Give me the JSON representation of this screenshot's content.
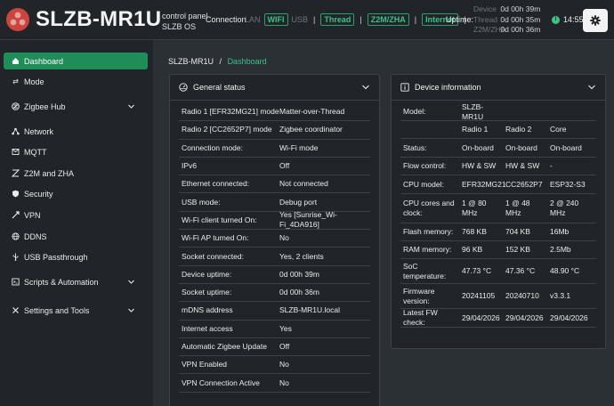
{
  "header": {
    "brand": "SLZB-MR1U",
    "sub_line1": "control panel",
    "sub_line2": "SLZB OS",
    "connection_label": "Connection",
    "conn": {
      "lan": "LAN",
      "wifi": "WIFI",
      "usb": "USB",
      "thread": "Thread",
      "z2m": "Z2M/ZHA",
      "internet": "Internet"
    },
    "uptime_label": "Uptime:",
    "uptime": [
      {
        "key": "Device",
        "value": "0d 00h 39m"
      },
      {
        "key": "Thread",
        "value": "0d 00h 35m"
      },
      {
        "key": "Z2M/ZHA",
        "value": "0d 00h 36m"
      }
    ],
    "time": "14:55",
    "accent": "#3cc287",
    "logo_color": "#c9453e"
  },
  "sidebar": {
    "items": [
      {
        "label": "Dashboard",
        "icon": "home-icon",
        "active": true
      },
      {
        "label": "Mode",
        "icon": "swap-icon"
      },
      {
        "label": "Zigbee Hub",
        "icon": "zigbee-icon",
        "chevron": true
      },
      {
        "label": "Network",
        "icon": "network-icon"
      },
      {
        "label": "MQTT",
        "icon": "mqtt-icon"
      },
      {
        "label": "Z2M and ZHA",
        "icon": "z2m-icon"
      },
      {
        "label": "Security",
        "icon": "shield-icon"
      },
      {
        "label": "VPN",
        "icon": "vpn-icon"
      },
      {
        "label": "DDNS",
        "icon": "ddns-icon"
      },
      {
        "label": "USB Passthrough",
        "icon": "usb-icon"
      },
      {
        "label": "Scripts & Automation",
        "icon": "code-icon",
        "chevron": true
      },
      {
        "label": "Settings and Tools",
        "icon": "tools-icon",
        "chevron": true
      }
    ]
  },
  "breadcrumb": {
    "root": "SLZB-MR1U",
    "sep": "/",
    "current": "Dashboard"
  },
  "general": {
    "title": "General status",
    "rows": [
      {
        "k": "Radio 1 [EFR32MG21] mode",
        "v": "Matter-over-Thread"
      },
      {
        "k": "Radio 2 [CC2652P7] mode",
        "v": "Zigbee coordinator"
      },
      {
        "k": "Connection mode:",
        "v": "Wi-Fi mode"
      },
      {
        "k": "IPv6",
        "v": "Off"
      },
      {
        "k": "Ethernet connected:",
        "v": "Not connected"
      },
      {
        "k": "USB mode:",
        "v": "Debug port"
      },
      {
        "k": "Wi-Fi client turned On:",
        "v": "Yes [Sunrise_Wi-Fi_4DA916]"
      },
      {
        "k": "Wi-Fi AP turned On:",
        "v": "No"
      },
      {
        "k": "Socket connected:",
        "v": "Yes, 2 clients"
      },
      {
        "k": "Device uptime:",
        "v": "0d 00h 39m"
      },
      {
        "k": "Socket uptime:",
        "v": "0d 00h 36m"
      },
      {
        "k": "mDNS address",
        "v": "SLZB-MR1U.local"
      },
      {
        "k": "Internet access",
        "v": "Yes"
      },
      {
        "k": "Automatic Zigbee Update",
        "v": "Off"
      },
      {
        "k": "VPN Enabled",
        "v": "No"
      },
      {
        "k": "VPN Connection Active",
        "v": "No"
      }
    ]
  },
  "device": {
    "title": "Device information",
    "rows": [
      {
        "k": "Model:",
        "a": "SLZB-MR1U",
        "b": "",
        "c": ""
      },
      {
        "k": "",
        "a": "Radio 1",
        "b": "Radio 2",
        "c": "Core"
      },
      {
        "k": "Status:",
        "a": "On-board",
        "b": "On-board",
        "c": "On-board"
      },
      {
        "k": "Flow control:",
        "a": "HW & SW",
        "b": "HW & SW",
        "c": "-"
      },
      {
        "k": "CPU model:",
        "a": "EFR32MG21",
        "b": "CC2652P7",
        "c": "ESP32-S3"
      },
      {
        "k": "CPU cores and clock:",
        "a": "1 @ 80 MHz",
        "b": "1 @ 48 MHz",
        "c": "2 @ 240 MHz"
      },
      {
        "k": "Flash memory:",
        "a": "768 KB",
        "b": "704 KB",
        "c": "16Mb"
      },
      {
        "k": "RAM memory:",
        "a": "96 KB",
        "b": "152 KB",
        "c": "2.5Mb"
      },
      {
        "k": "SoC temperature:",
        "a": "47.73 °C",
        "b": "47.36 °C",
        "c": "48.90 °C"
      },
      {
        "k": "Firmware version:",
        "a": "20241105",
        "b": "20240710",
        "c": "v3.3.1"
      },
      {
        "k": "Latest FW check:",
        "a": "29/04/2026",
        "b": "29/04/2026",
        "c": "29/04/2026"
      }
    ]
  }
}
